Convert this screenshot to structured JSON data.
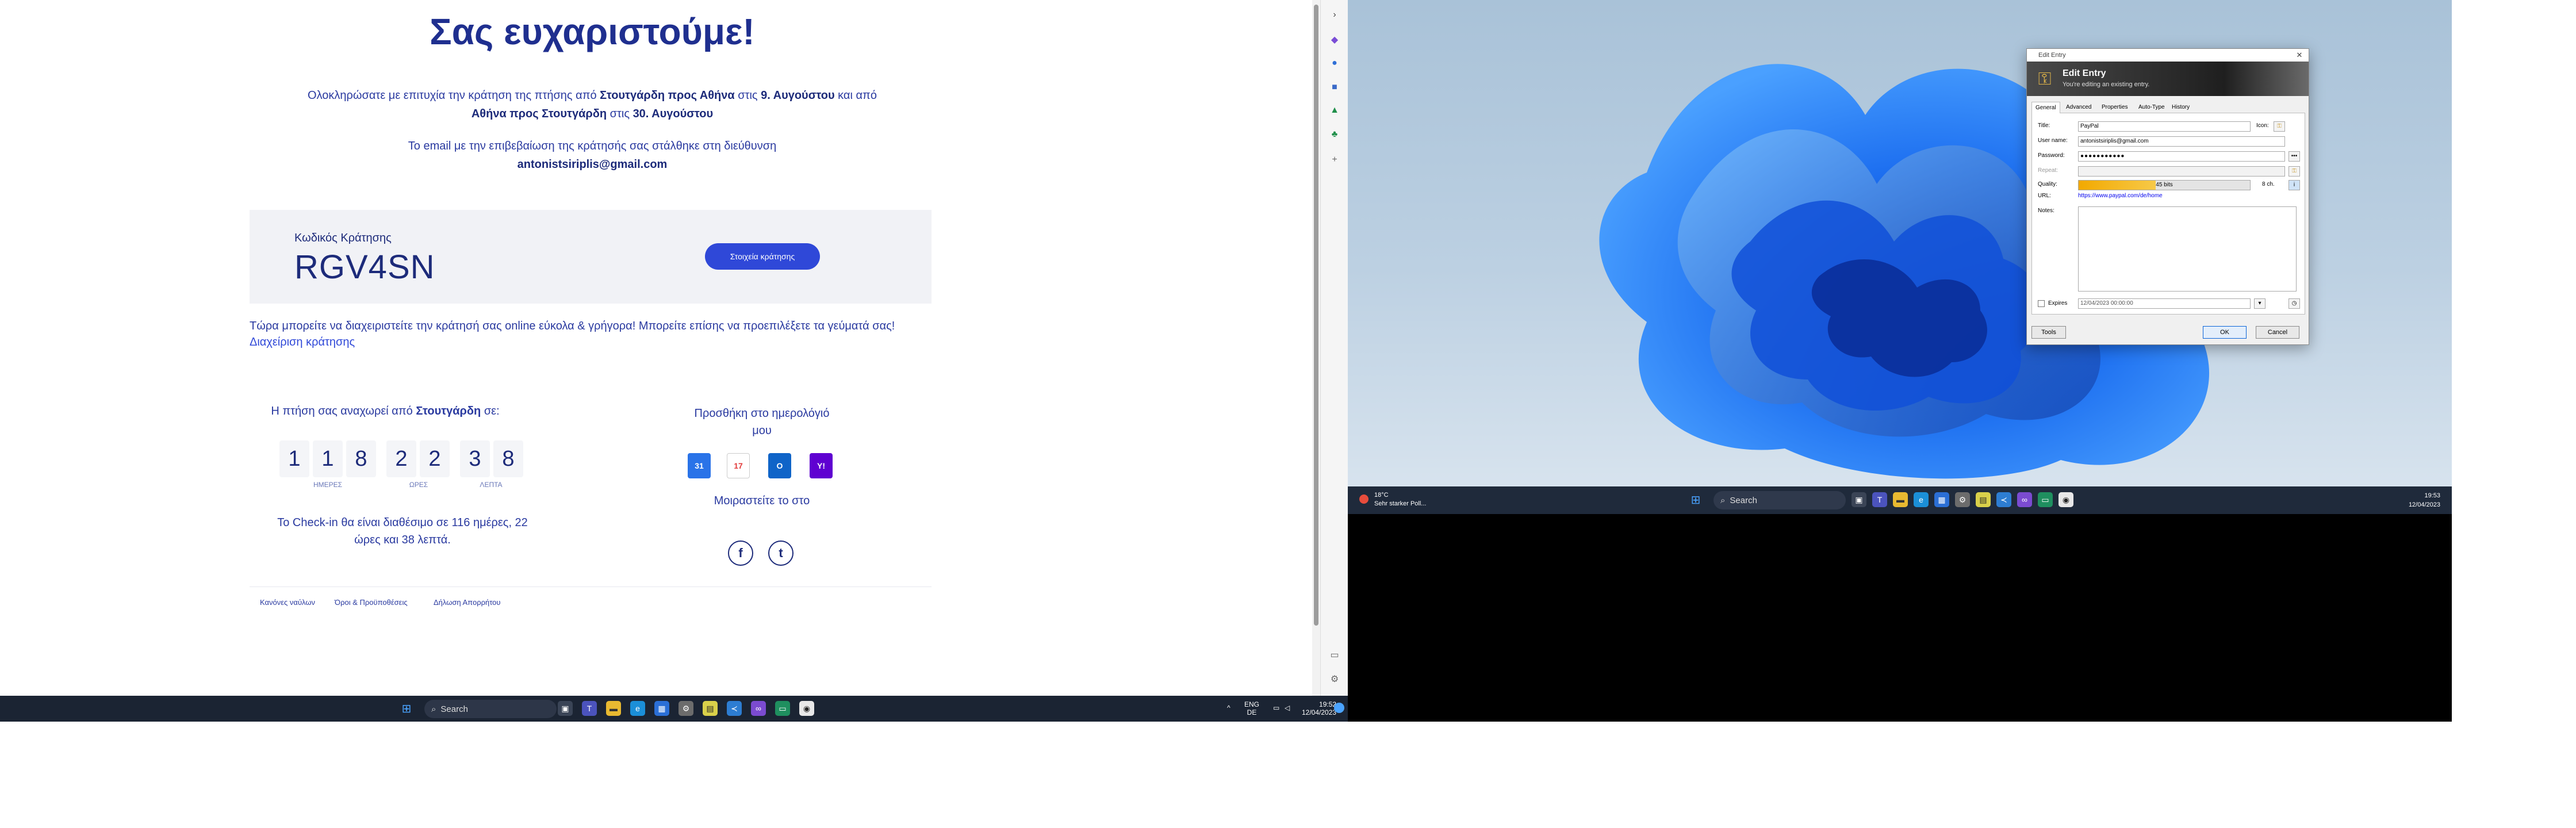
{
  "confirmation": {
    "title": "Σας ευχαριστούμε!",
    "line1_a": "Ολοκληρώσατε με επιτυχία την κράτηση της πτήσης από ",
    "line1_route": "Στουτγάρδη προς Αθήνα",
    "line1_b": " στις ",
    "line1_date": "9. Αυγούστου",
    "line1_c": " και από",
    "line2_route": "Αθήνα προς Στουτγάρδη",
    "line2_b": " στις ",
    "line2_date": "30. Αυγούστου",
    "email_text": "Το email με την επιβεβαίωση της κράτησής σας στάλθηκε στη διεύθυνση",
    "email": "antonistsiriplis@gmail.com",
    "code_label": "Κωδικός Κράτησης",
    "code_value": "RGV4SN",
    "details_button": "Στοιχεία κράτησης",
    "manage_text": "Τώρα μπορείτε να διαχειριστείτε την κράτησή σας online εύκολα & γρήγορα! Μπορείτε επίσης να προεπιλέξετε τα γεύματά σας!",
    "manage_link": "Διαχείριση κράτησης",
    "departs_a": "Η πτήση σας αναχωρεί από ",
    "departs_city": "Στουτγάρδη",
    "departs_b": " σε:",
    "countdown_digits": [
      "1",
      "1",
      "8",
      "2",
      "2",
      "3",
      "8"
    ],
    "countdown_labels": {
      "days": "ΗΜΕΡΕΣ",
      "hours": "ΩΡΕΣ",
      "minutes": "ΛΕΠΤΑ"
    },
    "checkin_text": "Το Check-in θα είναι διαθέσιμο σε 116 ημέρες, 22 ώρες και 38 λεπτά.",
    "calendar_title": "Προσθήκη στο ημερολόγιό μου",
    "calendar_icons": [
      "google-calendar-icon",
      "apple-calendar-icon",
      "outlook-calendar-icon",
      "yahoo-calendar-icon"
    ],
    "calendar_glyphs": {
      "google": "31",
      "apple": "17",
      "outlook": "O",
      "yahoo": "Y!"
    },
    "share_title": "Μοιραστείτε το στο",
    "social": {
      "facebook": "f",
      "twitter": "t"
    },
    "footer": [
      "Κανόνες ναύλων",
      "Όροι & Προϋποθέσεις",
      "Δήλωση Απορρήτου"
    ]
  },
  "taskbar_left": {
    "search_placeholder": "Search",
    "tray_lang": "ENG",
    "tray_region": "DE",
    "time": "19:52",
    "date": "12/04/2023"
  },
  "taskbar_right": {
    "weather_temp": "18°C",
    "weather_text": "Sehr starker Poll...",
    "search_placeholder": "Search",
    "time": "19:53",
    "date": "12/04/2023"
  },
  "dialog": {
    "window_title": "Edit Entry",
    "header_title": "Edit Entry",
    "header_subtitle": "You're editing an existing entry.",
    "tabs": [
      "General",
      "Advanced",
      "Properties",
      "Auto-Type",
      "History"
    ],
    "labels": {
      "title": "Title:",
      "username": "User name:",
      "password": "Password:",
      "repeat": "Repeat:",
      "quality": "Quality:",
      "url": "URL:",
      "notes": "Notes:",
      "icon": "Icon:",
      "expires": "Expires"
    },
    "values": {
      "title": "PayPal",
      "username": "antonistsiriplis@gmail.com",
      "password": "●●●●●●●●●●●",
      "quality": "45 bits",
      "quality_chars": "8 ch.",
      "url": "https://www.paypal.com/de/home",
      "expires": "12/04/2023 00:00:00"
    },
    "quality_fraction": 0.45,
    "buttons": {
      "tools": "Tools",
      "ok": "OK",
      "cancel": "Cancel"
    }
  },
  "colors": {
    "brand_navy": "#1d2b7a",
    "brand_blue": "#2f48d8",
    "panel_bg": "#f1f2f6"
  }
}
